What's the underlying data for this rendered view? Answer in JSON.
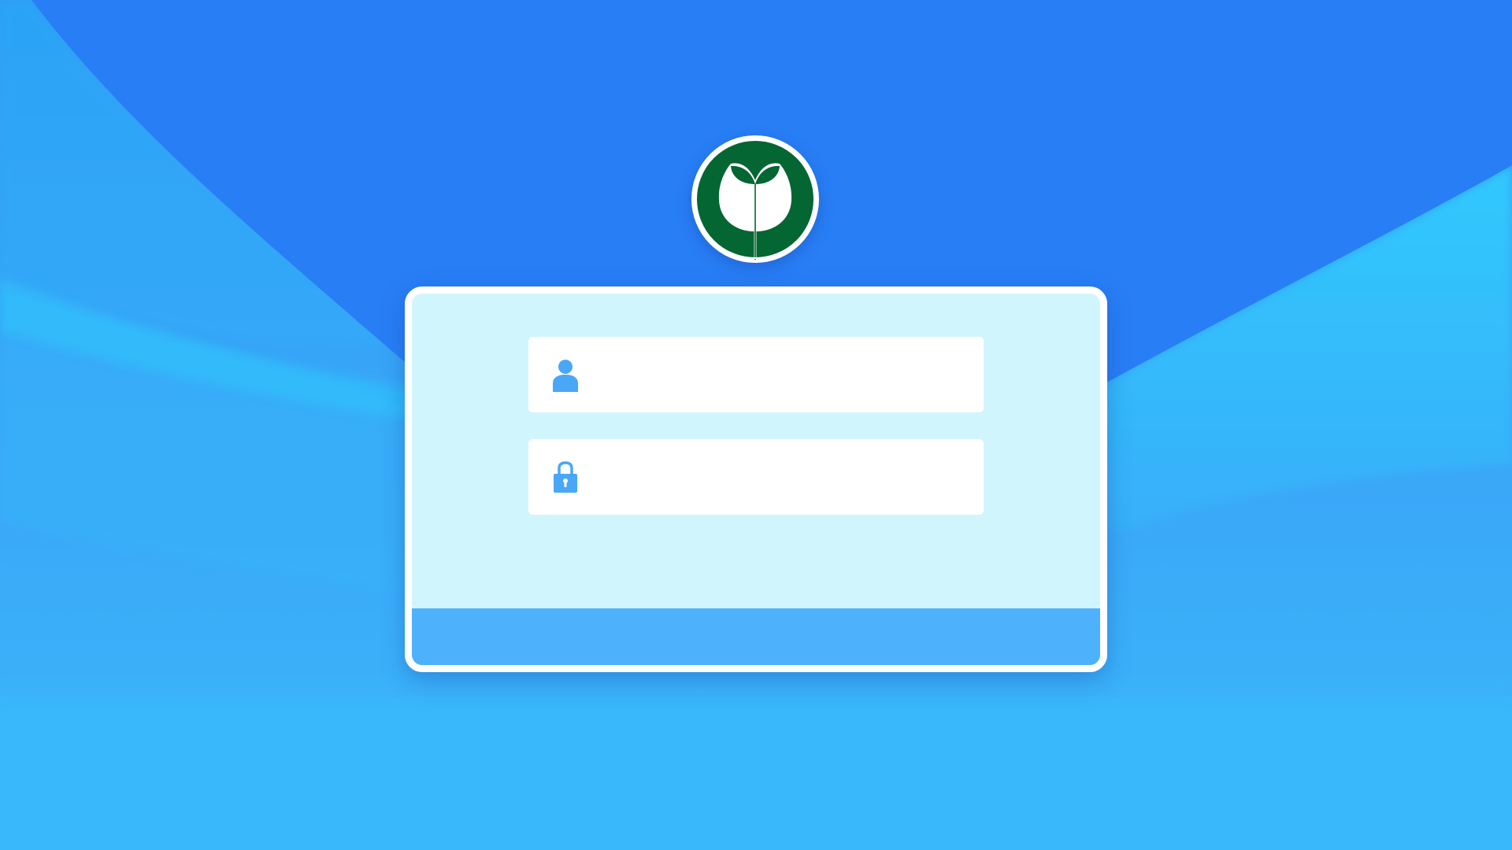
{
  "colors": {
    "background_dark": "#287ef5",
    "background_light": "#33c8fd",
    "card_fill": "#d1f5fd",
    "card_border": "#ffffff",
    "footer_fill": "#4db1fb",
    "icon_color": "#4aa7f7",
    "logo_green": "#046632"
  },
  "logo": {
    "icon": "sprout-logo-icon"
  },
  "login_form": {
    "username": {
      "icon": "user-icon",
      "value": "",
      "placeholder": ""
    },
    "password": {
      "icon": "lock-icon",
      "value": "",
      "placeholder": ""
    },
    "submit_label": ""
  }
}
